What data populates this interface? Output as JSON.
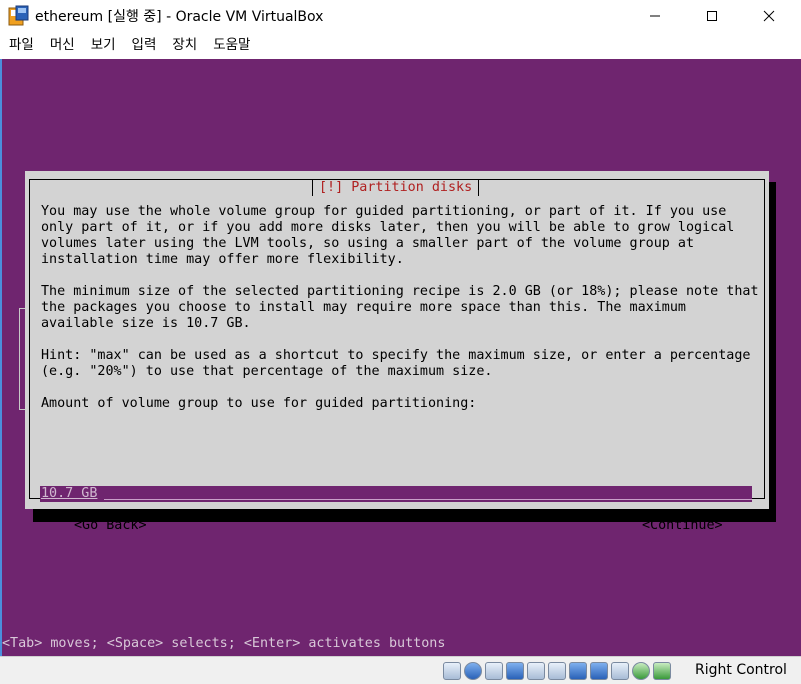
{
  "window": {
    "title": "ethereum [실행 중] - Oracle VM VirtualBox"
  },
  "menu": {
    "items": [
      "파일",
      "머신",
      "보기",
      "입력",
      "장치",
      "도움말"
    ]
  },
  "dialog": {
    "title": "[!] Partition disks",
    "paragraphs": [
      "You may use the whole volume group for guided partitioning, or part of it. If you use\nonly part of it, or if you add more disks later, then you will be able to grow logical\nvolumes later using the LVM tools, so using a smaller part of the volume group at\ninstallation time may offer more flexibility.",
      "The minimum size of the selected partitioning recipe is 2.0 GB (or 18%); please note that\nthe packages you choose to install may require more space than this. The maximum\navailable size is 10.7 GB.",
      "Hint: \"max\" can be used as a shortcut to specify the maximum size, or enter a percentage\n(e.g. \"20%\") to use that percentage of the maximum size.",
      "Amount of volume group to use for guided partitioning:"
    ],
    "input_value": "10.7 GB",
    "go_back_label": "<Go Back>",
    "continue_label": "<Continue>"
  },
  "hint_line": "<Tab> moves; <Space> selects; <Enter> activates buttons",
  "statusbar": {
    "host_key_label": "Right Control",
    "icons": [
      "hard-disk-icon",
      "optical-drive-icon",
      "audio-icon",
      "network-icon",
      "usb-icon",
      "shared-folder-icon",
      "display-icon",
      "video-capture-icon",
      "cpu-icon",
      "mouse-integration-icon",
      "keyboard-icon"
    ]
  },
  "colors": {
    "console_background": "#6f256f",
    "dialog_background": "#d3d3d3",
    "dialog_title": "#b02020"
  }
}
